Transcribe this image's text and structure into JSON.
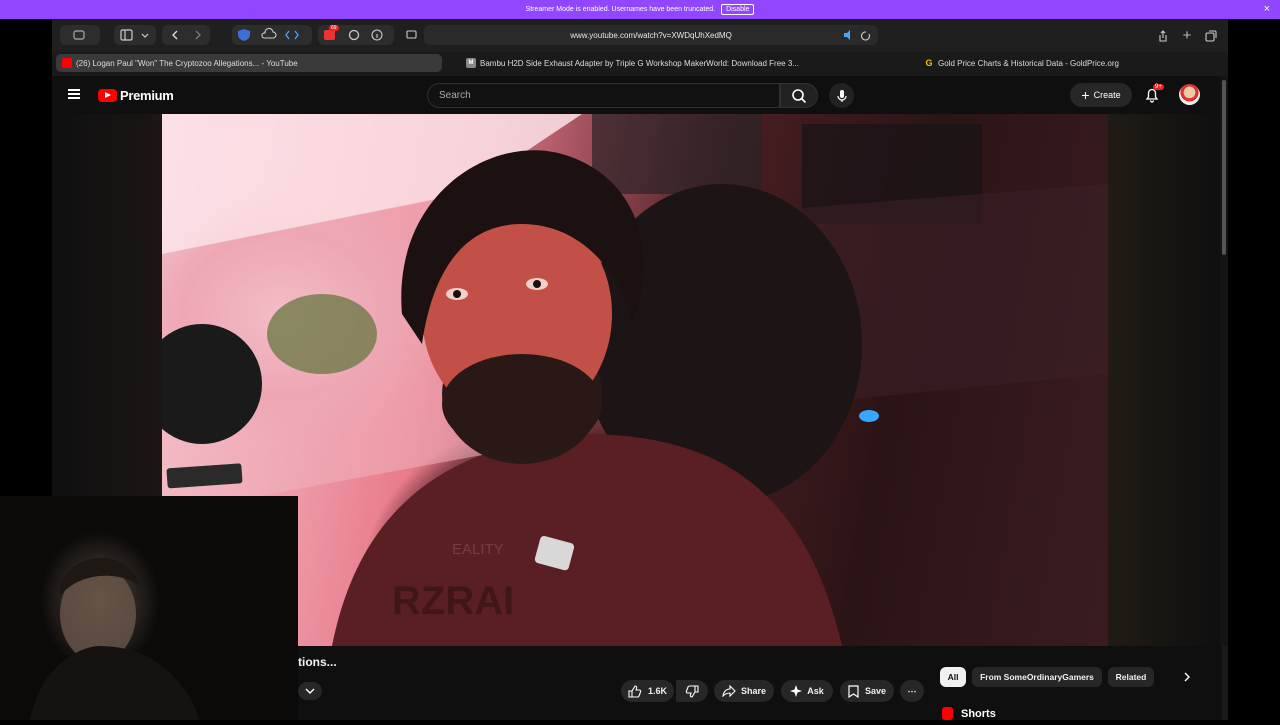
{
  "banner": {
    "text": "Streamer Mode is enabled. Usernames have been truncated.",
    "disable_label": "Disable",
    "close": "×"
  },
  "browser": {
    "url": "www.youtube.com/watch?v=XWDqUhXedMQ",
    "ext_badge": "69",
    "tabs": [
      {
        "label": "(26) Logan Paul \"Won\" The Cryptozoo Allegations... - YouTube",
        "active": true
      },
      {
        "label": "Bambu H2D Side Exhaust Adapter by Triple G Workshop MakerWorld: Download Free 3...",
        "fav_letter": "M"
      },
      {
        "label": "Gold Price Charts & Historical Data - GoldPrice.org",
        "fav_letter": "G"
      }
    ]
  },
  "youtube": {
    "logo_text": "Premium",
    "search_placeholder": "Search",
    "create_label": "Create",
    "notifications": "9+",
    "title_fragment": "tions...",
    "actions": {
      "likes": "1.6K",
      "share": "Share",
      "ask": "Ask",
      "save": "Save",
      "more": "⋯"
    },
    "chips": [
      "All",
      "From SomeOrdinaryGamers",
      "Related"
    ],
    "shorts_label": "Shorts"
  },
  "colors": {
    "banner": "#9147ff",
    "accent_red": "#ff0000",
    "page_bg": "#0f0f0f"
  }
}
